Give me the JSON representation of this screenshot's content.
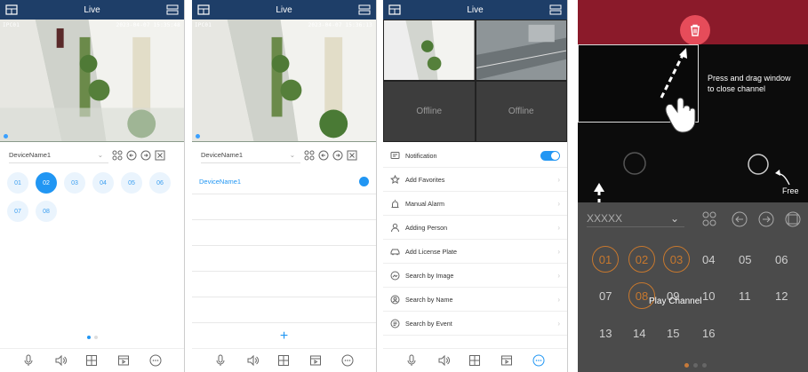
{
  "s1": {
    "title": "Live",
    "osd_left": "IPC01",
    "osd_right": "2023-04-07 15:35:48",
    "device": "DeviceName1",
    "channels": [
      "01",
      "02",
      "03",
      "04",
      "05",
      "06",
      "07",
      "08"
    ],
    "selected": "02"
  },
  "s2": {
    "title": "Live",
    "osd_left": "IPC01",
    "osd_right": "2023-04-07 15:36:13",
    "device": "DeviceName1",
    "list_item": "DeviceName1",
    "add": "+"
  },
  "s3": {
    "title": "Live",
    "offline_1": "Offline",
    "offline_2": "Offline",
    "menu": [
      "Notification",
      "Add Favorites",
      "Manual Alarm",
      "Adding Person",
      "Add License Plate",
      "Search by Image",
      "Search by Name",
      "Search by Event"
    ]
  },
  "s4": {
    "tip": "Press and drag window to close channel",
    "free": "Free",
    "device": "XXXXX",
    "play_channel": "Play Channel",
    "nums": [
      "01",
      "02",
      "03",
      "04",
      "05",
      "06",
      "07",
      "08",
      "09",
      "10",
      "11",
      "12",
      "13",
      "14",
      "15",
      "16"
    ]
  },
  "colors": {
    "accent": "#2196f3",
    "topbar": "#1e3e68",
    "delete": "#e64c5a"
  }
}
